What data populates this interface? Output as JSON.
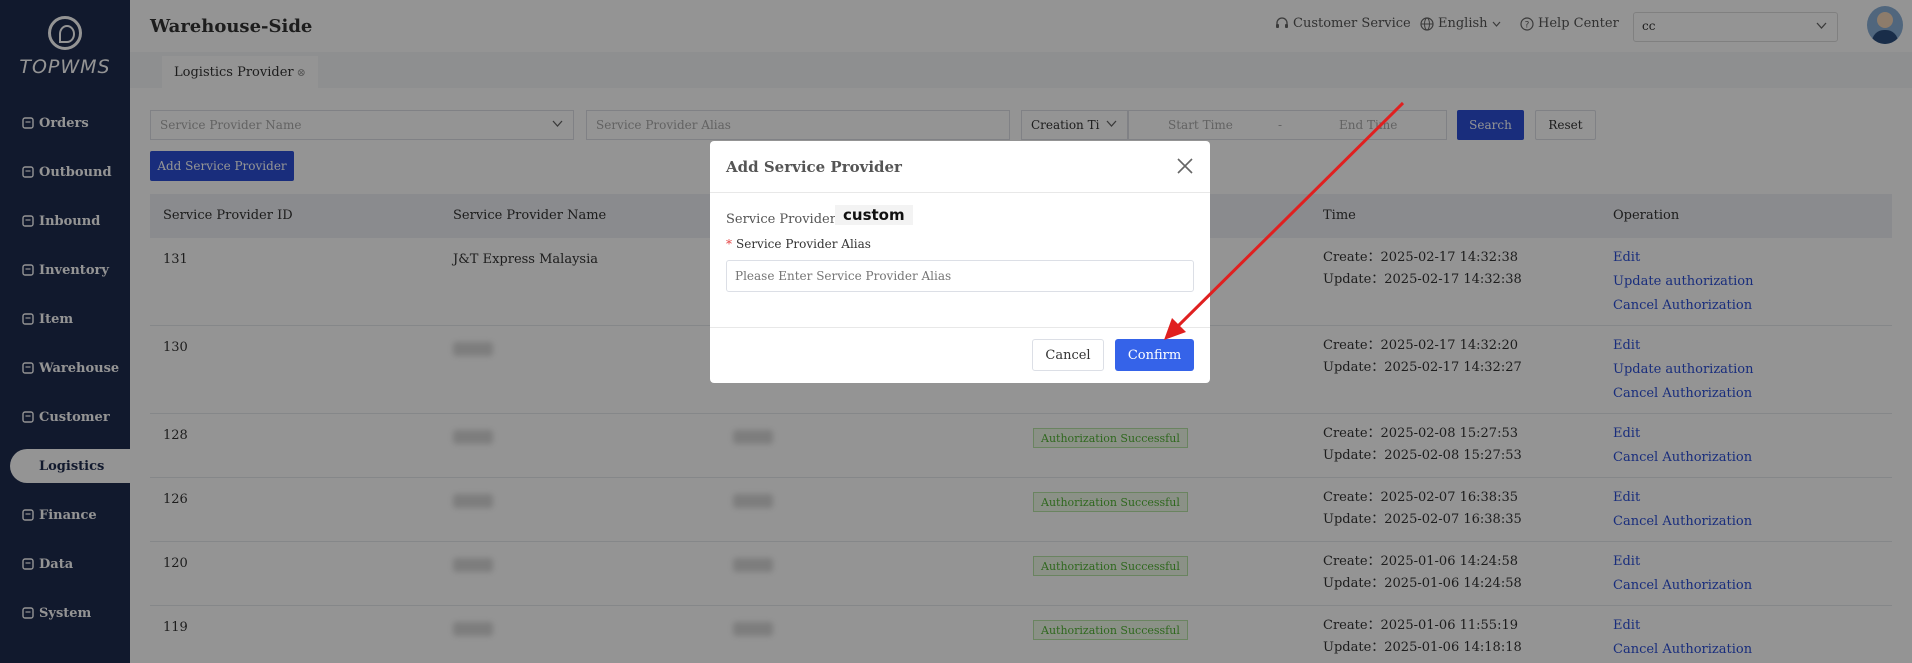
{
  "app": {
    "title": "Warehouse-Side",
    "brand": "TOPWMS"
  },
  "header": {
    "customer_service": "Customer Service",
    "language": "English",
    "help_center": "Help Center",
    "account_select": "cc"
  },
  "sidebar": {
    "items": [
      {
        "label": "Orders",
        "icon": "orders-icon"
      },
      {
        "label": "Outbound",
        "icon": "outbound-icon"
      },
      {
        "label": "Inbound",
        "icon": "inbound-icon"
      },
      {
        "label": "Inventory",
        "icon": "inventory-icon"
      },
      {
        "label": "Item",
        "icon": "item-icon"
      },
      {
        "label": "Warehouse",
        "icon": "warehouse-icon"
      },
      {
        "label": "Customer",
        "icon": "customer-icon"
      },
      {
        "label": "Logistics",
        "icon": "logistics-icon",
        "active": true
      },
      {
        "label": "Finance",
        "icon": "finance-icon"
      },
      {
        "label": "Data",
        "icon": "data-icon"
      },
      {
        "label": "System",
        "icon": "system-icon"
      }
    ]
  },
  "tabs": {
    "active": "Logistics Provider"
  },
  "filters": {
    "provider_name_placeholder": "Service Provider Name",
    "provider_alias_placeholder": "Service Provider Alias",
    "time_type": "Creation Ti",
    "start_time_placeholder": "Start Time",
    "range_separator": "-",
    "end_time_placeholder": "End Time",
    "search_label": "Search",
    "reset_label": "Reset",
    "add_label": "Add Service Provider"
  },
  "table": {
    "columns": {
      "id": "Service Provider ID",
      "name": "Service Provider Name",
      "time": "Time",
      "operation": "Operation"
    },
    "rows": [
      {
        "id": "131",
        "name": "J&T Express Malaysia",
        "status": "",
        "create": "Create：2025-02-17 14:32:38",
        "update": "Update：2025-02-17 14:32:38",
        "ops": [
          "Edit",
          "Update authorization",
          "Cancel Authorization"
        ]
      },
      {
        "id": "130",
        "name": "",
        "status": "",
        "create": "Create：2025-02-17 14:32:20",
        "update": "Update：2025-02-17 14:32:27",
        "ops": [
          "Edit",
          "Update authorization",
          "Cancel Authorization"
        ]
      },
      {
        "id": "128",
        "name": "",
        "status": "Authorization Successful",
        "create": "Create：2025-02-08 15:27:53",
        "update": "Update：2025-02-08 15:27:53",
        "ops": [
          "Edit",
          "Cancel Authorization"
        ]
      },
      {
        "id": "126",
        "name": "",
        "status": "Authorization Successful",
        "create": "Create：2025-02-07 16:38:35",
        "update": "Update：2025-02-07 16:38:35",
        "ops": [
          "Edit",
          "Cancel Authorization"
        ]
      },
      {
        "id": "120",
        "name": "",
        "status": "Authorization Successful",
        "create": "Create：2025-01-06 14:24:58",
        "update": "Update：2025-01-06 14:24:58",
        "ops": [
          "Edit",
          "Cancel Authorization"
        ]
      },
      {
        "id": "119",
        "name": "",
        "status": "Authorization Successful",
        "create": "Create：2025-01-06 11:55:19",
        "update": "Update：2025-01-06 14:18:18",
        "ops": [
          "Edit",
          "Cancel Authorization"
        ]
      }
    ]
  },
  "modal": {
    "title": "Add Service Provider",
    "provider_label": "Service Provider：",
    "provider_value": "custom",
    "required_mark": "*",
    "alias_label": "Service Provider Alias",
    "alias_placeholder": "Please Enter Service Provider Alias",
    "cancel_label": "Cancel",
    "confirm_label": "Confirm"
  },
  "colors": {
    "sidebar_bg": "#1e2b4f",
    "primary": "#2b4fd6",
    "confirm": "#3563e9",
    "arrow": "#e02020",
    "success": "#52b335"
  }
}
